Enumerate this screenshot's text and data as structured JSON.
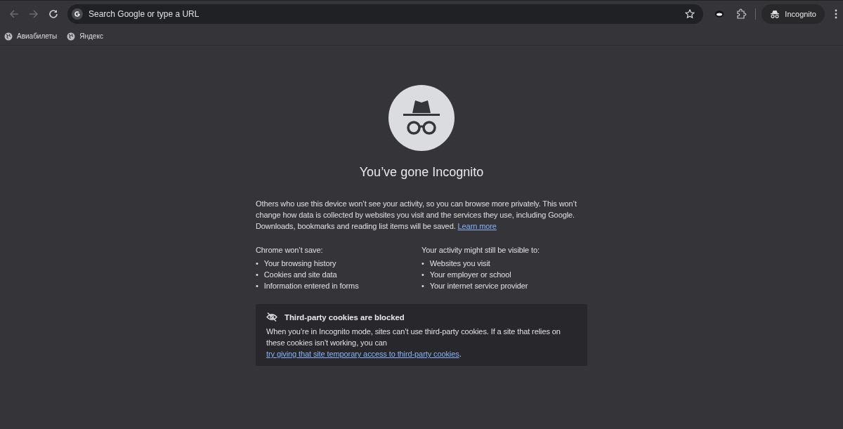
{
  "toolbar": {
    "back_disabled": true,
    "forward_disabled": true,
    "omnibox": {
      "placeholder": "Search Google or type a URL"
    },
    "profile": "Incognito"
  },
  "bookmarks": [
    "Авиабилеты",
    "Яндекс"
  ],
  "main": {
    "title": "You’ve gone Incognito",
    "intro": "Others who use this device won’t see your activity, so you can browse more privately. This won’t change how data is collected by websites you visit and the services they use, including Google. Downloads, bookmarks and reading list items will be saved.",
    "learn_more": "Learn more",
    "bullet": "•",
    "columns": [
      {
        "heading": "Chrome won’t save:",
        "items": [
          "Your browsing history",
          "Cookies and site data",
          "Information entered in forms"
        ]
      },
      {
        "heading": "Your activity might still be visible to:",
        "items": [
          "Websites you visit",
          "Your employer or school",
          "Your internet service provider"
        ]
      }
    ],
    "cookie_card": {
      "title": "Third-party cookies are blocked",
      "text": "When you’re in Incognito mode, sites can’t use third-party cookies. If a site that relies on these cookies isn’t working, you can",
      "link": "try giving that site temporary access to third-party cookies",
      "after": "."
    }
  }
}
